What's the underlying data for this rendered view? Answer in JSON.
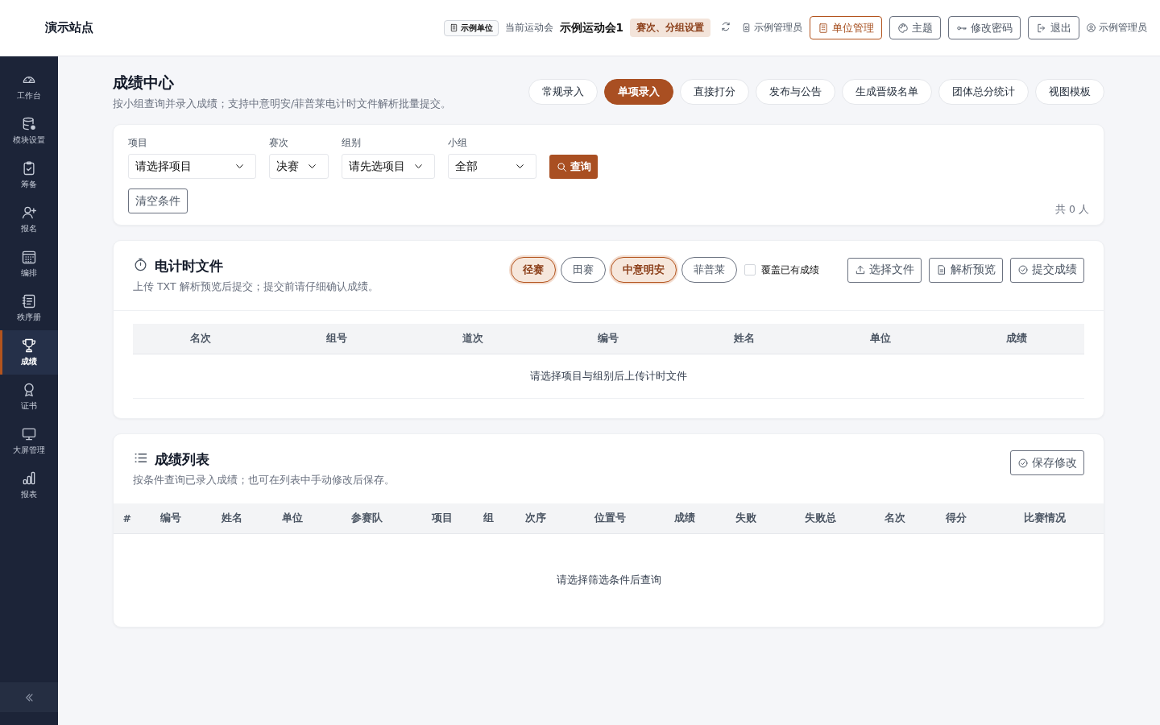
{
  "header": {
    "site_title": "演示站点",
    "unit_badge": "示例单位",
    "meet_label": "当前运动会",
    "meet_name": "示例运动会1",
    "meet_settings": "赛次、分组设置",
    "role": "示例管理员",
    "buttons": [
      {
        "label": "单位管理",
        "kind": "primary"
      },
      {
        "label": "主题",
        "kind": "plain"
      },
      {
        "label": "修改密码",
        "kind": "plain"
      },
      {
        "label": "退出",
        "kind": "plain"
      }
    ],
    "user": "示例管理员"
  },
  "sidebar": {
    "items": [
      {
        "label": "工作台",
        "selected": false
      },
      {
        "label": "模块设置",
        "selected": false
      },
      {
        "label": "筹备",
        "selected": false
      },
      {
        "label": "报名",
        "selected": false
      },
      {
        "label": "编排",
        "selected": false
      },
      {
        "label": "秩序册",
        "selected": false
      },
      {
        "label": "成绩",
        "selected": true
      },
      {
        "label": "证书",
        "selected": false
      },
      {
        "label": "大屏管理",
        "selected": false
      },
      {
        "label": "报表",
        "selected": false
      }
    ]
  },
  "page": {
    "title": "成绩中心",
    "subtitle": "按小组查询并录入成绩；支持中意明安/菲普莱电计时文件解析批量提交。",
    "tabs": [
      {
        "label": "常规录入",
        "selected": false
      },
      {
        "label": "单项录入",
        "selected": true
      },
      {
        "label": "直接打分",
        "selected": false
      },
      {
        "label": "发布与公告",
        "selected": false
      },
      {
        "label": "生成晋级名单",
        "selected": false
      },
      {
        "label": "团体总分统计",
        "selected": false
      },
      {
        "label": "视图模板",
        "selected": false
      }
    ]
  },
  "filters": {
    "fields": [
      {
        "label": "项目",
        "value": "请选择项目"
      },
      {
        "label": "赛次",
        "value": "决赛"
      },
      {
        "label": "组别",
        "value": "请先选项目"
      },
      {
        "label": "小组",
        "value": "全部"
      }
    ],
    "query_button": "查询",
    "clear_button": "清空条件",
    "count": "共 0 人"
  },
  "timing": {
    "title": "电计时文件",
    "subtitle": "上传 TXT 解析预览后提交；提交前请仔细确认成绩。",
    "event_types": [
      {
        "label": "径赛",
        "selected": true
      },
      {
        "label": "田赛",
        "selected": false
      }
    ],
    "vendors": [
      {
        "label": "中意明安",
        "selected": true
      },
      {
        "label": "菲普莱",
        "selected": false
      }
    ],
    "overwrite": {
      "label": "覆盖已有成绩",
      "checked": false
    },
    "buttons": [
      {
        "label": "选择文件",
        "kind": "upload"
      },
      {
        "label": "解析预览",
        "kind": "preview"
      },
      {
        "label": "提交成绩",
        "kind": "submit"
      }
    ],
    "columns": [
      "名次",
      "组号",
      "道次",
      "编号",
      "姓名",
      "单位",
      "成绩"
    ],
    "empty": "请选择项目与组别后上传计时文件"
  },
  "results": {
    "title": "成绩列表",
    "subtitle": "按条件查询已录入成绩；也可在列表中手动修改后保存。",
    "save_button": "保存修改",
    "columns": [
      "#",
      "编号",
      "姓名",
      "单位",
      "参赛队",
      "项目",
      "组",
      "次序",
      "位置号",
      "成绩",
      "失败",
      "失败总",
      "名次",
      "得分",
      "比赛情况"
    ],
    "empty": "请选择筛选条件后查询"
  }
}
